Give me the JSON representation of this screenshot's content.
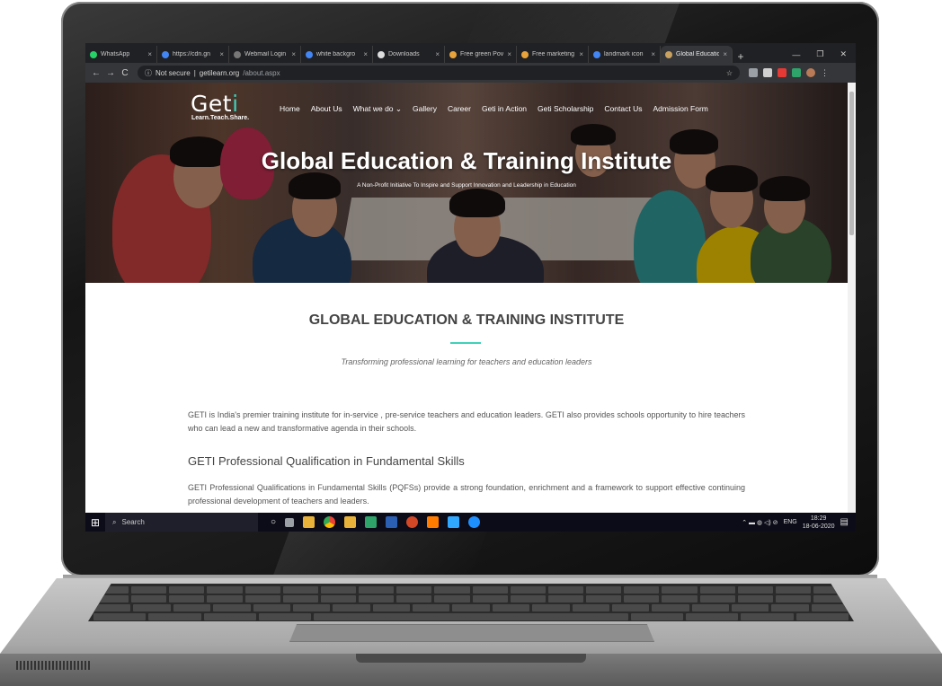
{
  "browser": {
    "tabs": [
      {
        "label": "WhatsApp",
        "fav_color": "#25d366",
        "active": false
      },
      {
        "label": "https://cdn.gn",
        "fav_color": "#4285f4",
        "active": false
      },
      {
        "label": "Webmail Login",
        "fav_color": "#777777",
        "active": false
      },
      {
        "label": "white backgro",
        "fav_color": "#4285f4",
        "active": false
      },
      {
        "label": "Downloads",
        "fav_color": "#dddddd",
        "active": false
      },
      {
        "label": "Free green Pov",
        "fav_color": "#e8a33a",
        "active": false
      },
      {
        "label": "Free marketing",
        "fav_color": "#e8a33a",
        "active": false
      },
      {
        "label": "landmark icon",
        "fav_color": "#4285f4",
        "active": false
      },
      {
        "label": "Global Educatio",
        "fav_color": "#c8a060",
        "active": true
      }
    ],
    "close_glyph": "×",
    "new_tab": "+",
    "window_controls": [
      "—",
      "❐",
      "✕"
    ],
    "nav": {
      "back": "←",
      "forward": "→",
      "reload": "C"
    },
    "url": {
      "security": "Not secure",
      "domain": "getilearn.org",
      "path": "/about.aspx"
    },
    "extension_colors": [
      "#9aa0a6",
      "#d0d0d0",
      "#e53935",
      "#2ea36a",
      "#b97a57"
    ]
  },
  "site": {
    "logo_main": "Get",
    "logo_accent": "i",
    "logo_tagline": "Learn.Teach.Share.",
    "nav": [
      "Home",
      "About Us",
      "What we do ⌄",
      "Gallery",
      "Career",
      "Geti in Action",
      "Geti Scholarship",
      "Contact Us",
      "Admission Form"
    ],
    "hero_title": "Global Education & Training Institute",
    "hero_subtitle": "A Non-Profit Initiative To Inspire and Support Innovation and Leadership in Education",
    "section_title": "GLOBAL EDUCATION & TRAINING INSTITUTE",
    "section_subtitle": "Transforming professional learning for teachers and education leaders",
    "intro": "GETI is India's premier training institute for in-service , pre-service teachers and education leaders. GETI also provides schools opportunity to hire teachers who can lead a new and transformative agenda in their schools.",
    "subheading": "GETI Professional Qualification in Fundamental Skills",
    "pqfs_text": "GETI Professional Qualifications in Fundamental Skills (PQFSs) provide a strong foundation, enrichment and a framework to support effective continuing professional development of teachers and leaders."
  },
  "taskbar": {
    "start_icon": "windows-icon",
    "search_label": "Search",
    "app_icon_colors": [
      "#ffffff",
      "#9aa0a6",
      "#e8b23a",
      "#4285f4",
      "#e8b23a",
      "#2ea36a",
      "#2b5fb4",
      "#d24726",
      "#ff7c00",
      "#31a8ff",
      "#1e90ff"
    ],
    "tray_glyphs": "⌃ ▬ ◍ ◁) ⊘",
    "language": "ENG",
    "time": "18:29",
    "date": "18-06-2020"
  }
}
